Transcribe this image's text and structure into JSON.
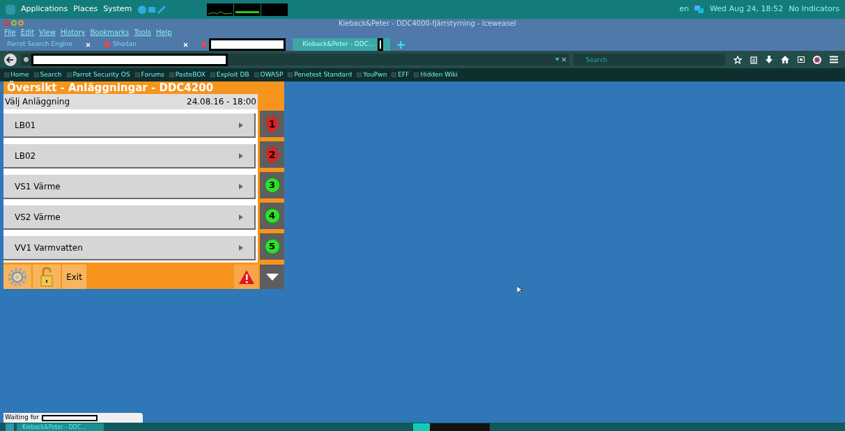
{
  "top_panel": {
    "menus": [
      "Applications",
      "Places",
      "System"
    ],
    "keyboard": "en",
    "clock": "Wed Aug 24, 18:52",
    "indicators": "No Indicators"
  },
  "window": {
    "title": "Kieback&Peter - DDC4000-fjärrstyrning - Iceweasel"
  },
  "menu": [
    "File",
    "Edit",
    "View",
    "History",
    "Bookmarks",
    "Tools",
    "Help"
  ],
  "tabs": [
    {
      "label": "Parrot Search Engine",
      "selected": false
    },
    {
      "label": "Shodan",
      "selected": false
    },
    {
      "selected": false
    },
    {
      "label": "Kieback&Peter - DDC...",
      "selected": true
    }
  ],
  "search": {
    "placeholder": "Search"
  },
  "bookmarks": [
    "Home",
    "Search",
    "Parrot Security OS",
    "Forums",
    "PasteBOX",
    "Exploit DB",
    "OWASP",
    "Penetest Standard",
    "YouPwn",
    "EFF",
    "Hidden Wiki"
  ],
  "panel": {
    "title": "Översikt - Anläggningar - DDC4200",
    "subtitle": "Välj Anläggning",
    "timestamp": "24.08.16 - 18:00",
    "items": [
      {
        "label": "LB01",
        "badge": "1",
        "kind": "alarm"
      },
      {
        "label": "LB02",
        "badge": "2",
        "kind": "alarm"
      },
      {
        "label": "VS1 Värme",
        "badge": "3",
        "kind": "ok"
      },
      {
        "label": "VS2 Värme",
        "badge": "4",
        "kind": "ok"
      },
      {
        "label": "VV1 Varmvatten",
        "badge": "5",
        "kind": "ok"
      }
    ],
    "exit": "Exit"
  },
  "status_bar": "Waiting for",
  "taskbar": [
    "Kieback&Peter - DDC..."
  ]
}
